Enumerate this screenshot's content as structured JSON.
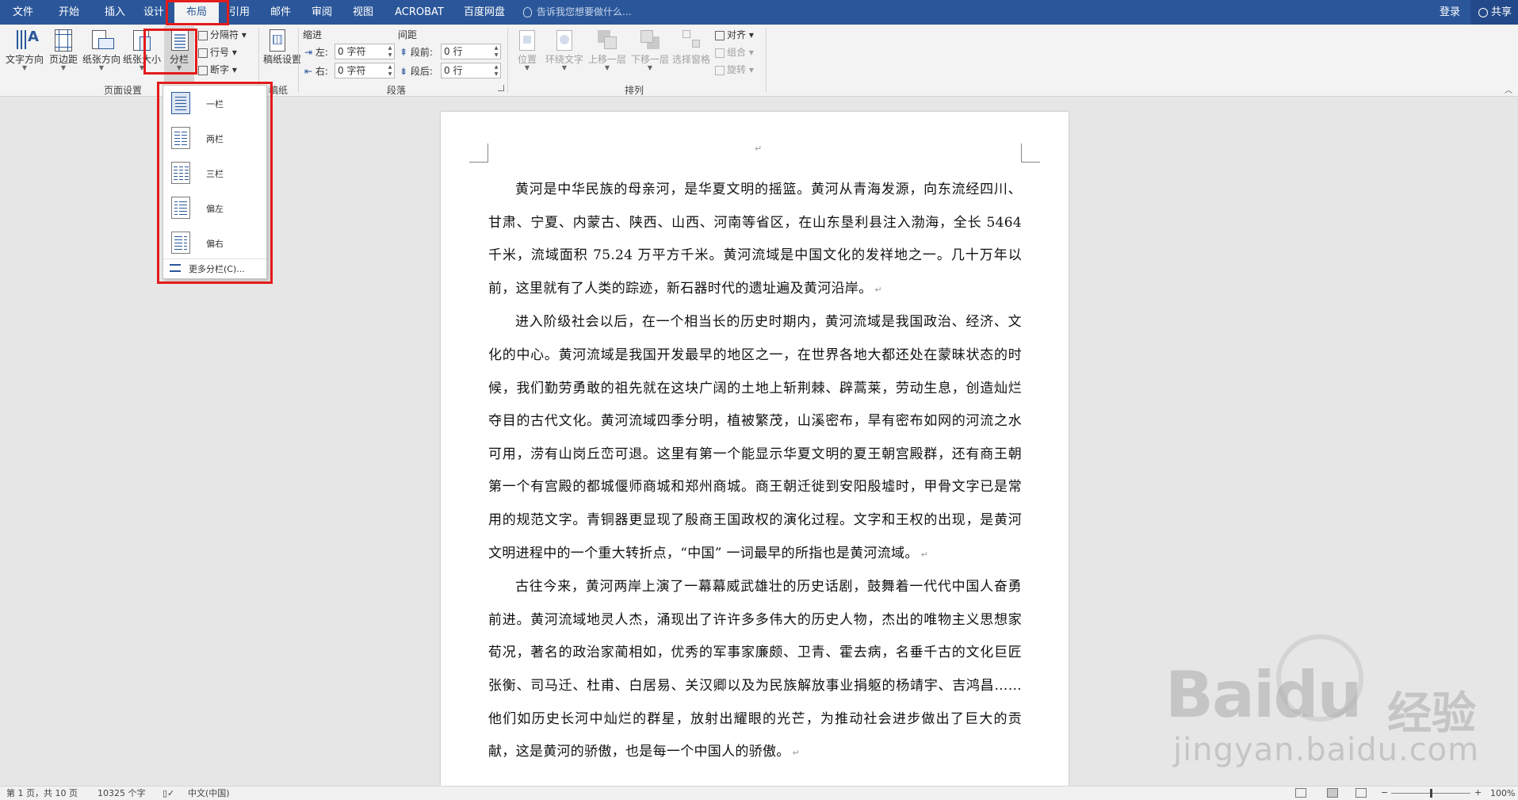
{
  "tabs": [
    {
      "label": "文件",
      "active": false
    },
    {
      "label": "开始",
      "active": false
    },
    {
      "label": "插入",
      "active": false
    },
    {
      "label": "设计",
      "active": false
    },
    {
      "label": "布局",
      "active": true
    },
    {
      "label": "引用",
      "active": false
    },
    {
      "label": "邮件",
      "active": false
    },
    {
      "label": "审阅",
      "active": false
    },
    {
      "label": "视图",
      "active": false
    },
    {
      "label": "ACROBAT",
      "active": false
    },
    {
      "label": "百度网盘",
      "active": false
    }
  ],
  "tell_me": "告诉我您想要做什么...",
  "login": "登录",
  "share": "共享",
  "ribbon": {
    "page_setup": {
      "text_direction": "文字方向",
      "margins": "页边距",
      "orientation": "纸张方向",
      "size": "纸张大小",
      "columns": "分栏",
      "breaks": "分隔符",
      "line_numbers": "行号",
      "hyphenation": "断字",
      "group_label": "页面设置"
    },
    "draft": {
      "label": "稿纸设置",
      "group_label": "稿纸"
    },
    "paragraph": {
      "indent_header": "缩进",
      "spacing_header": "间距",
      "left_label": "左:",
      "left_value": "0 字符",
      "right_label": "右:",
      "right_value": "0 字符",
      "before_label": "段前:",
      "before_value": "0 行",
      "after_label": "段后:",
      "after_value": "0 行",
      "group_label": "段落"
    },
    "arrange": {
      "position": "位置",
      "wrap_text": "环绕文字",
      "bring_forward": "上移一层",
      "send_backward": "下移一层",
      "selection_pane": "选择窗格",
      "align": "对齐",
      "group": "组合",
      "rotate": "旋转",
      "group_label": "排列"
    }
  },
  "columns_menu": {
    "items": [
      {
        "label": "一栏",
        "icon": "one-column-icon",
        "selected": true
      },
      {
        "label": "两栏",
        "icon": "two-columns-icon",
        "selected": false
      },
      {
        "label": "三栏",
        "icon": "three-columns-icon",
        "selected": false
      },
      {
        "label": "偏左",
        "icon": "left-column-icon",
        "selected": false
      },
      {
        "label": "偏右",
        "icon": "right-column-icon",
        "selected": false
      }
    ],
    "more": "更多分栏(C)..."
  },
  "document": {
    "paragraphs": [
      "黄河是中华民族的母亲河，是华夏文明的摇篮。黄河从青海发源，向东流经四川、甘肃、宁夏、内蒙古、陕西、山西、河南等省区，在山东垦利县注入渤海，全长 5464 千米，流域面积 75.24 万平方千米。黄河流域是中国文化的发祥地之一。几十万年以前，这里就有了人类的踪迹，新石器时代的遗址遍及黄河沿岸。",
      "进入阶级社会以后，在一个相当长的历史时期内，黄河流域是我国政治、经济、文化的中心。黄河流域是我国开发最早的地区之一，在世界各地大都还处在蒙昧状态的时候，我们勤劳勇敢的祖先就在这块广阔的土地上斩荆棘、辟蒿莱，劳动生息，创造灿烂夺目的古代文化。黄河流域四季分明，植被繁茂，山溪密布，旱有密布如网的河流之水可用，涝有山岗丘峦可退。这里有第一个能显示华夏文明的夏王朝宫殿群，还有商王朝第一个有宫殿的都城偃师商城和郑州商城。商王朝迁徙到安阳殷墟时，甲骨文字已是常用的规范文字。青铜器更显现了殷商王国政权的演化过程。文字和王权的出现，是黄河文明进程中的一个重大转折点，“中国” 一词最早的所指也是黄河流域。",
      "古往今来，黄河两岸上演了一幕幕威武雄壮的历史话剧，鼓舞着一代代中国人奋勇前进。黄河流域地灵人杰，涌现出了许许多多伟大的历史人物，杰出的唯物主义思想家荀况，著名的政治家蔺相如，优秀的军事家廉颇、卫青、霍去病，名垂千古的文化巨匠张衡、司马迁、杜甫、白居易、关汉卿以及为民族解放事业捐躯的杨靖宇、吉鸿昌……他们如历史长河中灿烂的群星，放射出耀眼的光芒，为推动社会进步做出了巨大的贡献，这是黄河的骄傲，也是每一个中国人的骄傲。"
    ]
  },
  "status": {
    "page": "第 1 页，共 10 页",
    "words": "10325 个字",
    "language": "中文(中国)",
    "zoom_label": "100%",
    "zoom": 100
  },
  "watermark": {
    "brand": "Bai",
    "brand_end": "du",
    "cn": "经验",
    "url": "jingyan.baidu.com"
  },
  "colors": {
    "accent": "#2b579a",
    "highlight": "#e31b1b"
  }
}
